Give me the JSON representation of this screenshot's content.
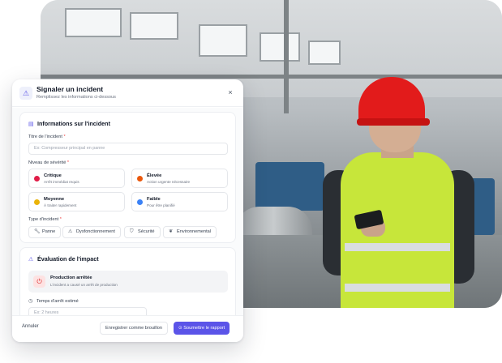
{
  "modal": {
    "title": "Signaler un incident",
    "subtitle": "Remplissez les informations ci-dessous",
    "close_icon": "×"
  },
  "info_section": {
    "title": "Informations sur l'incident",
    "title_field": {
      "label": "Titre de l'incident",
      "required": "*",
      "placeholder": "Ex: Compresseur principal en panne"
    },
    "severity": {
      "label": "Niveau de sévérité",
      "required": "*",
      "options": [
        {
          "name": "Critique",
          "desc": "Arrêt immédiat requis",
          "color": "#e11d48"
        },
        {
          "name": "Élevée",
          "desc": "Action urgente nécessaire",
          "color": "#ea580c"
        },
        {
          "name": "Moyenne",
          "desc": "À traiter rapidement",
          "color": "#eab308"
        },
        {
          "name": "Faible",
          "desc": "Pour être planifié",
          "color": "#3b82f6"
        }
      ]
    },
    "type": {
      "label": "Type d'incident",
      "required": "*",
      "options": [
        {
          "label": "Panne",
          "icon": "wrench-icon"
        },
        {
          "label": "Dysfonctionnement",
          "icon": "warning-icon"
        },
        {
          "label": "Sécurité",
          "icon": "shield-icon"
        },
        {
          "label": "Environnemental",
          "icon": "leaf-icon"
        }
      ]
    }
  },
  "impact_section": {
    "title": "Évaluation de l'impact",
    "production": {
      "name": "Production arrêtée",
      "desc": "L'incident a causé un arrêt de production",
      "icon": "power-icon"
    },
    "downtime": {
      "label": "Temps d'arrêt estimé",
      "placeholder": "Ex: 2 heures"
    }
  },
  "footer": {
    "cancel": "Annuler",
    "draft": "Enregistrer comme brouillon",
    "submit": "Soumettre le rapport"
  },
  "colors": {
    "accent": "#5b54e8",
    "danger": "#dc2626"
  }
}
